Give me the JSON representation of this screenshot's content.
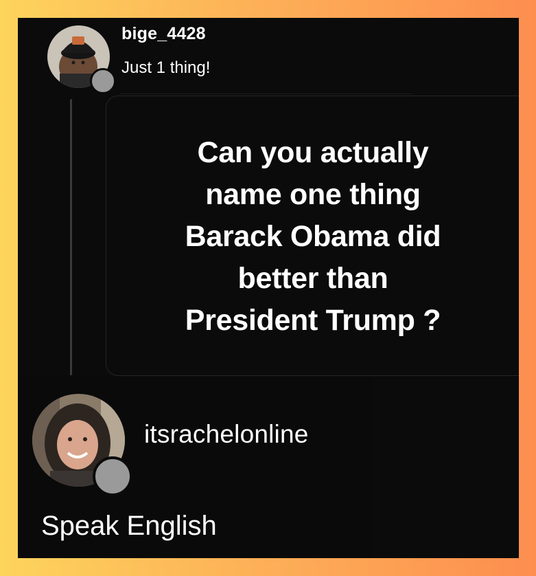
{
  "post": {
    "username": "bige_4428",
    "caption": "Just 1 thing!",
    "quote_lines": [
      "Can you actually",
      "name one thing",
      "Barack Obama did",
      "better than",
      "President Trump ?"
    ]
  },
  "reply": {
    "username": "itsrachelonline",
    "caption": "Speak English"
  },
  "colors": {
    "background_gradient": [
      "#fdd45c",
      "#fd8e4f"
    ],
    "panel": "#0b0b0b",
    "text": "#ffffff",
    "badge": "#9a9a9a"
  },
  "icons": {
    "post_avatar": "user-avatar-photo",
    "reply_avatar": "user-avatar-photo",
    "status_badge": "circle-badge"
  }
}
